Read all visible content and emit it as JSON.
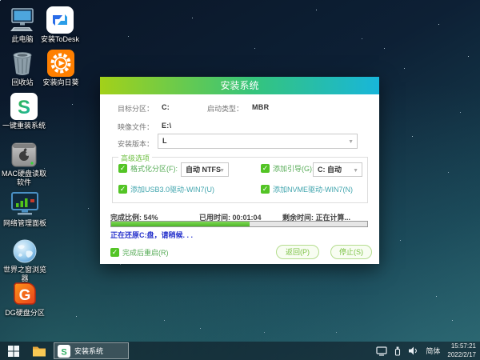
{
  "colors": {
    "title_gradient_left": "#a3d119",
    "title_gradient_mid": "#35c47c",
    "title_gradient_right": "#18b6da",
    "accent_green": "#53c425",
    "status_blue": "#2733cc",
    "progress_fill": "#5fc434"
  },
  "desktop": {
    "icons": [
      {
        "label": "此电脑"
      },
      {
        "label": "安装ToDesk"
      },
      {
        "label": "回收站"
      },
      {
        "label": "安装向日葵"
      },
      {
        "label": "一键重装系统"
      },
      {
        "label": "MAC硬盘读取软件"
      },
      {
        "label": "网络管理面板"
      },
      {
        "label": "世界之窗浏览器"
      },
      {
        "label": "DG硬盘分区"
      }
    ]
  },
  "dialog": {
    "title": "安装系统",
    "rows": {
      "target_label": "目标分区：",
      "target_value": "C:",
      "boot_label": "启动类型：",
      "boot_value": "MBR",
      "image_label": "映像文件：",
      "image_value": "E:\\",
      "version_label": "安装版本：",
      "version_value": "L"
    },
    "advanced": {
      "group_label": "高级选项",
      "format_label": "格式化分区(F):",
      "format_value": "自动 NTFS",
      "boot_add_label": "添加引导(G):",
      "boot_add_value": "C: 自动",
      "usb_label": "添加USB3.0驱动-WIN7(U)",
      "nvme_label": "添加NVME驱动-WIN7(N)"
    },
    "progress": {
      "percent": 54,
      "percent_text": "完成比例: 54%",
      "elapsed_text": "已用时间: 00:01:04",
      "remaining_text": "剩余时间: 正在计算...",
      "status_text": "正在还原C:盘，请稍候. . ."
    },
    "footer": {
      "restart_label": "完成后重启(R)",
      "back_label": "返回(P)",
      "stop_label": "停止(S)"
    }
  },
  "taskbar": {
    "app_label": "安装系统",
    "ime": "简体",
    "time": "15:57:21",
    "date": "2022/2/17"
  }
}
